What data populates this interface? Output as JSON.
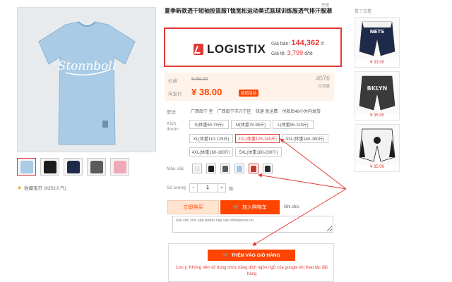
{
  "product": {
    "title": "夏季新款透干短袖投篮服T恤宽松运动美式篮球训练服透气排汗服潮",
    "top_tag": "举报",
    "favorites": "收藏宝贝 (9353人气)"
  },
  "logistix": {
    "brand": "LOGISTIX",
    "vnd_label": "Giá bán:",
    "vnd_price": "144,362",
    "vnd_unit": "đ",
    "cny_label": "Giá tệ:",
    "cny_price": "3,799",
    "cny_unit": "đ/tệ"
  },
  "pricing": {
    "orig_label": "价格",
    "orig_price": "¥ 68.00",
    "promo_label": "淘宝价",
    "promo_price": "¥ 38.00",
    "promo_badge": "促销活动",
    "sales_count": "4076",
    "sales_label": "月销量"
  },
  "shipping": {
    "label": "配送",
    "from": "广西南宁 至",
    "to": "广西南宁市兴宁区",
    "fee": "快递 免运费",
    "time": "付款后48小时内发货"
  },
  "sizes": {
    "label": "Kích thước",
    "options": [
      {
        "label": "S(体重60-75斤)",
        "selected": false
      },
      {
        "label": "M(体重75-95斤)",
        "selected": false
      },
      {
        "label": "L(体重95-110斤)",
        "selected": false
      },
      {
        "label": "XL(体重110-125斤)",
        "selected": false
      },
      {
        "label": "2XL(体重125-140斤)",
        "selected": true
      },
      {
        "label": "3XL(体重140-160斤)",
        "selected": false
      },
      {
        "label": "4XL(体重160-180斤)",
        "selected": false
      },
      {
        "label": "5XL(体重180-200斤)",
        "selected": false
      }
    ]
  },
  "colors": {
    "label": "Màu sắc",
    "swatches": [
      "#e9e9e9",
      "#1c1c1c",
      "#5a5a5a",
      "#9ec6e6",
      "#c0392b",
      "#2c2c2c"
    ],
    "selected_index": 4
  },
  "quantity": {
    "label": "Số lượng",
    "value": "1",
    "unit": "件",
    "minus": "−",
    "plus": "+"
  },
  "actions": {
    "buy_now": "立即购买",
    "add_cart": "加入购物车",
    "note_label": "Ghi chú:",
    "note_value": "Ghi chú cho sản phẩm này vào dhexpress.vn",
    "add_cart_vn": "THÊM VÀO GIỎ HÀNG",
    "warning": "Lưu ý: Không nên sử dụng chức năng dịch ngôn ngữ của google khi thao tác đặt hàng"
  },
  "sidebar": {
    "title": "看了又看",
    "items": [
      {
        "price": "¥ 33.00",
        "color": "#1e2a4a"
      },
      {
        "price": "¥ 35.00",
        "color": "#3a3a3a"
      },
      {
        "price": "¥ 35.00",
        "color": "#f2f2f2"
      }
    ]
  },
  "colors_theme": {
    "accent": "#ff4400",
    "alert": "#e53935",
    "shirt": "#a9cbe6"
  }
}
